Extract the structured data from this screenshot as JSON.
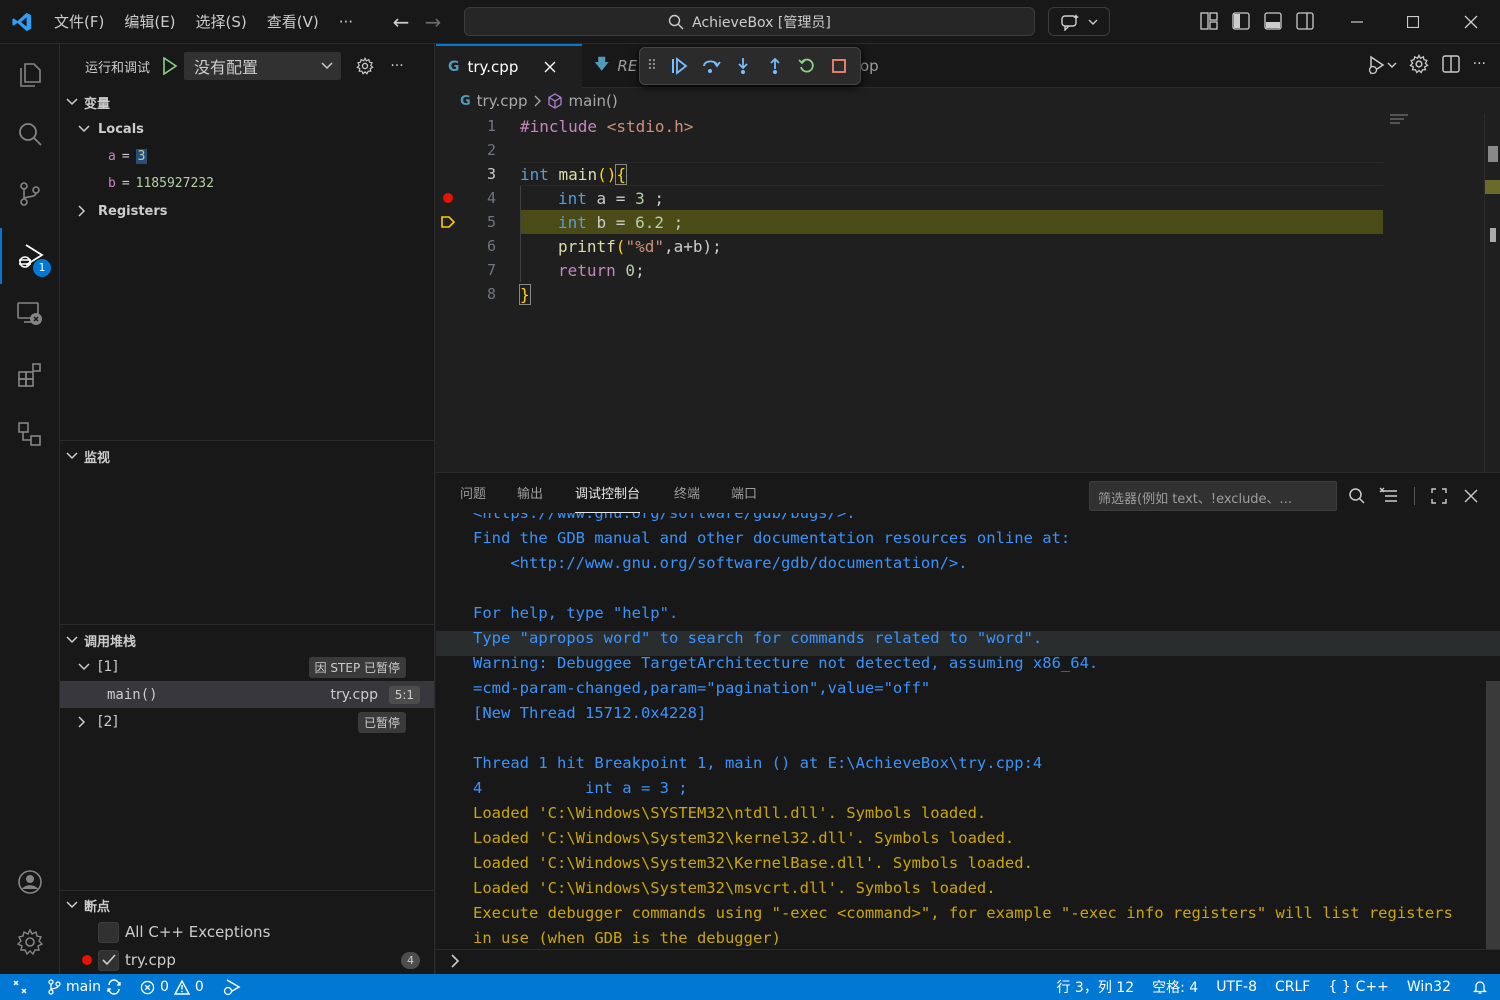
{
  "titlebar": {
    "menus": [
      "文件(F)",
      "编辑(E)",
      "选择(S)",
      "查看(V)",
      "···"
    ],
    "command_center": "AchieveBox [管理员]"
  },
  "activity": {
    "debug_badge": "1"
  },
  "sidebar": {
    "run_title": "运行和调试",
    "config": "没有配置",
    "variables": {
      "header": "变量",
      "locals_label": "Locals",
      "vars": [
        {
          "name": "a",
          "eq": "=",
          "value": "3"
        },
        {
          "name": "b",
          "eq": "=",
          "value": "1185927232"
        }
      ],
      "registers_label": "Registers"
    },
    "watch": {
      "header": "监视"
    },
    "callstack": {
      "header": "调用堆栈",
      "thread1": "[1]",
      "thread1_status": "因 STEP 已暂停",
      "frame_name": "main()",
      "frame_file": "try.cpp",
      "frame_pos": "5:1",
      "thread2": "[2]",
      "thread2_status": "已暂停"
    },
    "breakpoints": {
      "header": "断点",
      "items": [
        {
          "label": "All C++ Exceptions"
        },
        {
          "label": "try.cpp",
          "count": "4"
        }
      ]
    }
  },
  "editor": {
    "tabs": [
      {
        "label": "try.cpp"
      },
      {
        "label": "RE"
      },
      {
        "label": "op"
      }
    ],
    "breadcrumb": {
      "file": "try.cpp",
      "symbol": "main()"
    },
    "line_numbers": [
      "1",
      "2",
      "3",
      "4",
      "5",
      "6",
      "7",
      "8"
    ],
    "code": {
      "l1_pp": "#include",
      "l1_hdr": " <stdio.h>",
      "l3_kw": "int",
      "l3_fn": " main",
      "l3_paren": "()",
      "l3_brace": "{",
      "l4_kw": "int",
      "l4_rest": " a = ",
      "l4_num": "3",
      "l4_end": " ;",
      "l5_kw": "int",
      "l5_rest": " b = ",
      "l5_num": "6.2",
      "l5_end": " ;",
      "l6_fn": "printf",
      "l6_open": "(",
      "l6_str": "\"%d\"",
      "l6_rest": ",a+b);",
      "l7_kw": "return",
      "l7_num": " 0",
      "l7_end": ";",
      "l8_brace": "}"
    }
  },
  "panel": {
    "tabs": [
      "问题",
      "输出",
      "调试控制台",
      "终端",
      "端口"
    ],
    "filter_placeholder": "筛选器(例如 text、!exclude、...",
    "console_lines": [
      {
        "text": "<https://www.gnu.org/software/gdb/bugs/>.",
        "color": "blue"
      },
      {
        "text": "Find the GDB manual and other documentation resources online at:",
        "color": "blue"
      },
      {
        "text": "    <http://www.gnu.org/software/gdb/documentation/>.",
        "color": "blue"
      },
      {
        "text": "",
        "color": "blue"
      },
      {
        "text": "For help, type \"help\".",
        "color": "blue"
      },
      {
        "text": "Type \"apropos word\" to search for commands related to \"word\".",
        "color": "blue"
      },
      {
        "text": "Warning: Debuggee TargetArchitecture not detected, assuming x86_64.",
        "color": "blue"
      },
      {
        "text": "=cmd-param-changed,param=\"pagination\",value=\"off\"",
        "color": "blue"
      },
      {
        "text": "[New Thread 15712.0x4228]",
        "color": "blue"
      },
      {
        "text": "",
        "color": "blue"
      },
      {
        "text": "Thread 1 hit Breakpoint 1, main () at E:\\AchieveBox\\try.cpp:4",
        "color": "blue"
      },
      {
        "text": "4           int a = 3 ;",
        "color": "blue"
      },
      {
        "text": "Loaded 'C:\\Windows\\SYSTEM32\\ntdll.dll'. Symbols loaded.",
        "color": "orange"
      },
      {
        "text": "Loaded 'C:\\Windows\\System32\\kernel32.dll'. Symbols loaded.",
        "color": "orange"
      },
      {
        "text": "Loaded 'C:\\Windows\\System32\\KernelBase.dll'. Symbols loaded.",
        "color": "orange"
      },
      {
        "text": "Loaded 'C:\\Windows\\System32\\msvcrt.dll'. Symbols loaded.",
        "color": "orange"
      },
      {
        "text": "Execute debugger commands using \"-exec <command>\", for example \"-exec info registers\" will list registers",
        "color": "orange"
      },
      {
        "text": "in use (when GDB is the debugger)",
        "color": "orange"
      }
    ],
    "prompt": ">"
  },
  "statusbar": {
    "branch": "main",
    "errors": "0",
    "warnings": "0",
    "position": "行 3，列 12",
    "spaces": "空格: 4",
    "encoding": "UTF-8",
    "eol": "CRLF",
    "language": "C++",
    "platform": "Win32"
  },
  "colors": {
    "accent": "#0078d4",
    "breakpoint": "#e51400",
    "current_line": "#ffcc00",
    "highlight": "#4b4b18"
  }
}
